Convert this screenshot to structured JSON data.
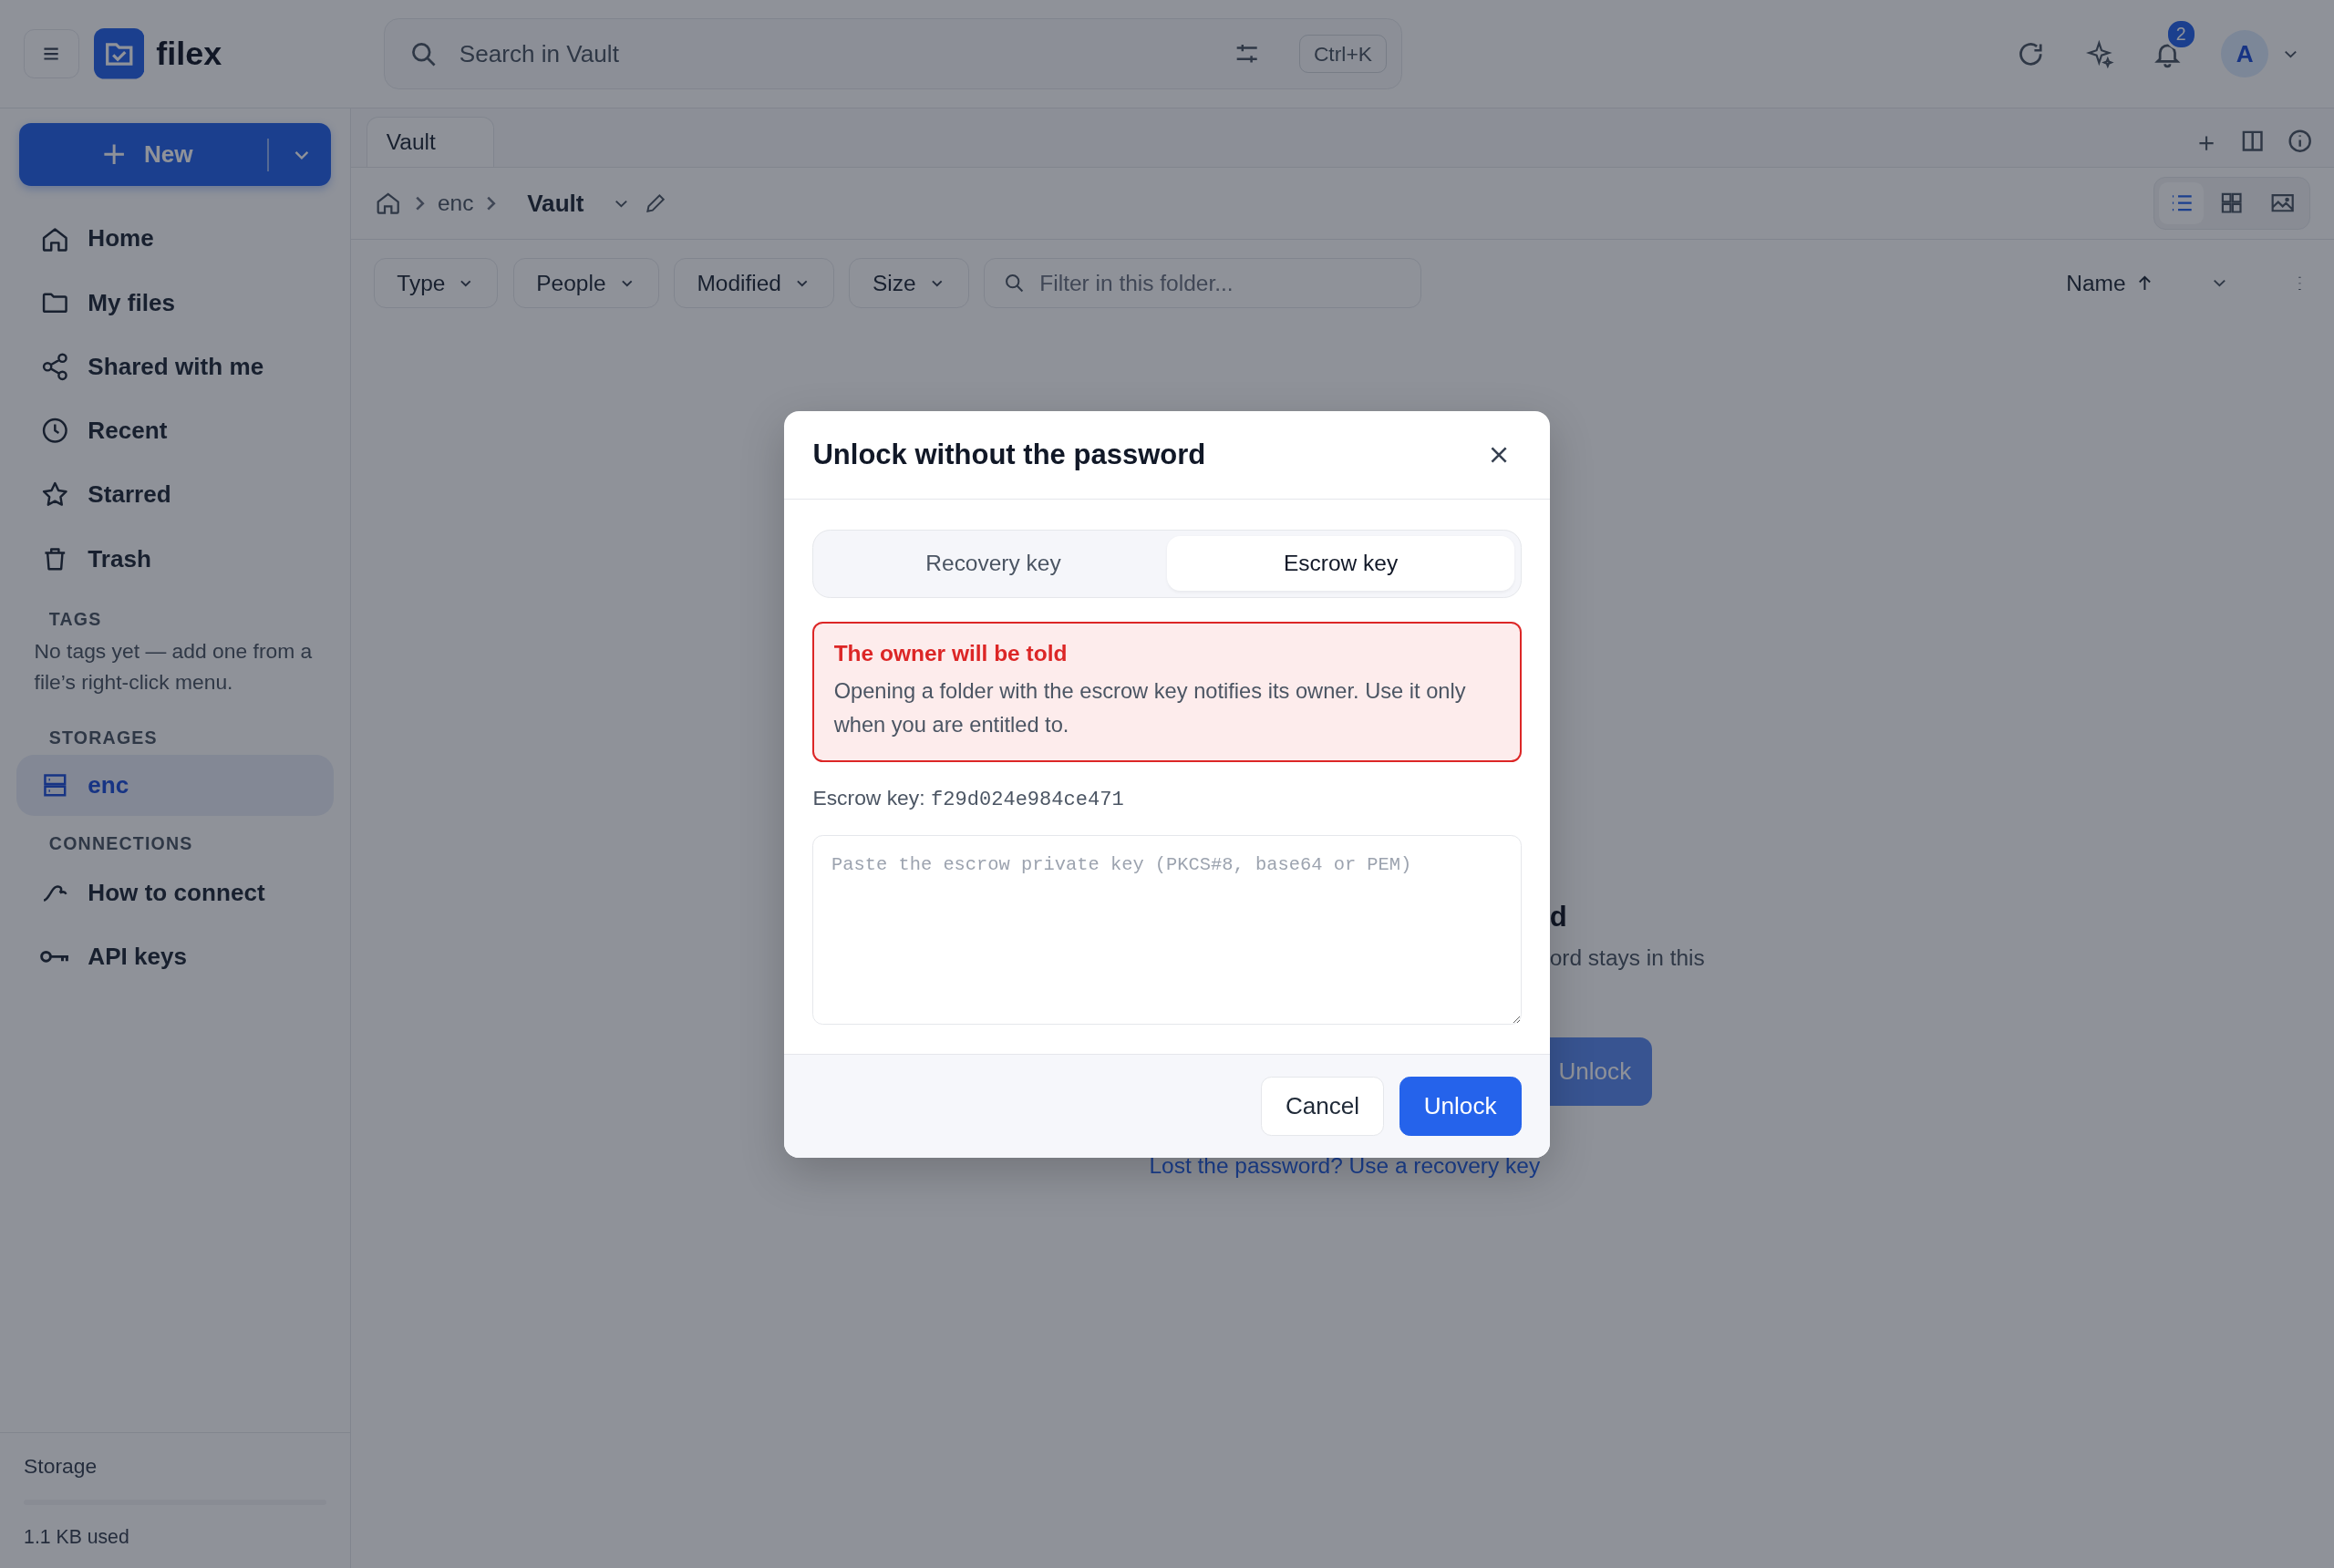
{
  "app": {
    "name": "filex"
  },
  "search": {
    "placeholder": "Search in Vault",
    "shortcut": "Ctrl+K"
  },
  "notifications": {
    "count": "2"
  },
  "avatar": {
    "initial": "A"
  },
  "new_button": {
    "label": "New"
  },
  "nav": [
    {
      "label": "Home"
    },
    {
      "label": "My files"
    },
    {
      "label": "Shared with me"
    },
    {
      "label": "Recent"
    },
    {
      "label": "Starred"
    },
    {
      "label": "Trash"
    }
  ],
  "tags": {
    "heading": "TAGS",
    "empty_text": "No tags yet — add one from a file’s right-click menu."
  },
  "storages": {
    "heading": "STORAGES",
    "items": [
      {
        "label": "enc",
        "selected": true
      }
    ]
  },
  "connections": {
    "heading": "CONNECTIONS",
    "items": [
      {
        "label": "How to connect"
      },
      {
        "label": "API keys"
      }
    ]
  },
  "storage_footer": {
    "title": "Storage",
    "usage": "1.1 KB used"
  },
  "tabs": [
    {
      "label": "Vault",
      "selected": true
    }
  ],
  "breadcrumb": {
    "path": [
      "enc"
    ],
    "current": "Vault"
  },
  "view_modes": [
    {
      "kind": "list",
      "selected": true
    },
    {
      "kind": "grid",
      "selected": false
    },
    {
      "kind": "gallery",
      "selected": false
    }
  ],
  "filters": [
    "Type",
    "People",
    "Modified",
    "Size"
  ],
  "filter_field": {
    "placeholder": "Filter in this folder..."
  },
  "sort": {
    "label": "Name"
  },
  "background": {
    "heading_tail": "d",
    "text_tail": "ord stays in this",
    "button": "Unlock",
    "link": "Lost the password? Use a recovery key"
  },
  "dialog": {
    "title": "Unlock without the password",
    "tabs": [
      {
        "label": "Recovery key",
        "selected": false
      },
      {
        "label": "Escrow key",
        "selected": true
      }
    ],
    "alert": {
      "title": "The owner will be told",
      "text": "Opening a folder with the escrow key notifies its owner. Use it only when you are entitled to."
    },
    "key_label": "Escrow key:",
    "key_value": "f29d024e984ce471",
    "key_field": {
      "placeholder": "Paste the escrow private key (PKCS#8, base64 or PEM)"
    },
    "buttons": [
      {
        "label": "Cancel",
        "kind": "secondary"
      },
      {
        "label": "Unlock",
        "kind": "primary"
      }
    ]
  }
}
